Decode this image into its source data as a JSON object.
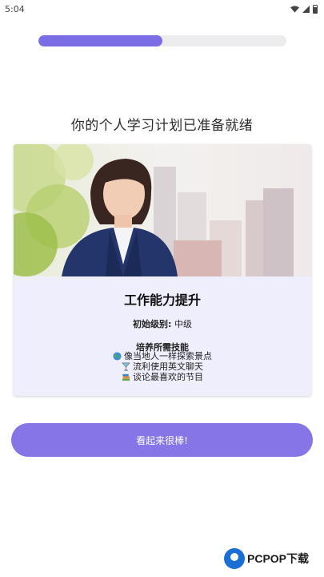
{
  "status_bar": {
    "time": "5:04"
  },
  "progress": {
    "fraction": 0.5,
    "color": "#7b6de3"
  },
  "headline": "你的个人学习计划已准备就绪",
  "card": {
    "title": "工作能力提升",
    "level_label": "初始级别:",
    "level_value": "中级",
    "skills_heading": "培养所需技能",
    "skills": [
      {
        "icon": "globe-icon",
        "text": "像当地人一样探索景点"
      },
      {
        "icon": "cocktail-icon",
        "text": "流利使用英文聊天"
      },
      {
        "icon": "books-icon",
        "text": "谈论最喜欢的节目"
      }
    ]
  },
  "cta": {
    "label": "看起来很棒!"
  },
  "watermark": {
    "text": "PCPOP下载"
  }
}
